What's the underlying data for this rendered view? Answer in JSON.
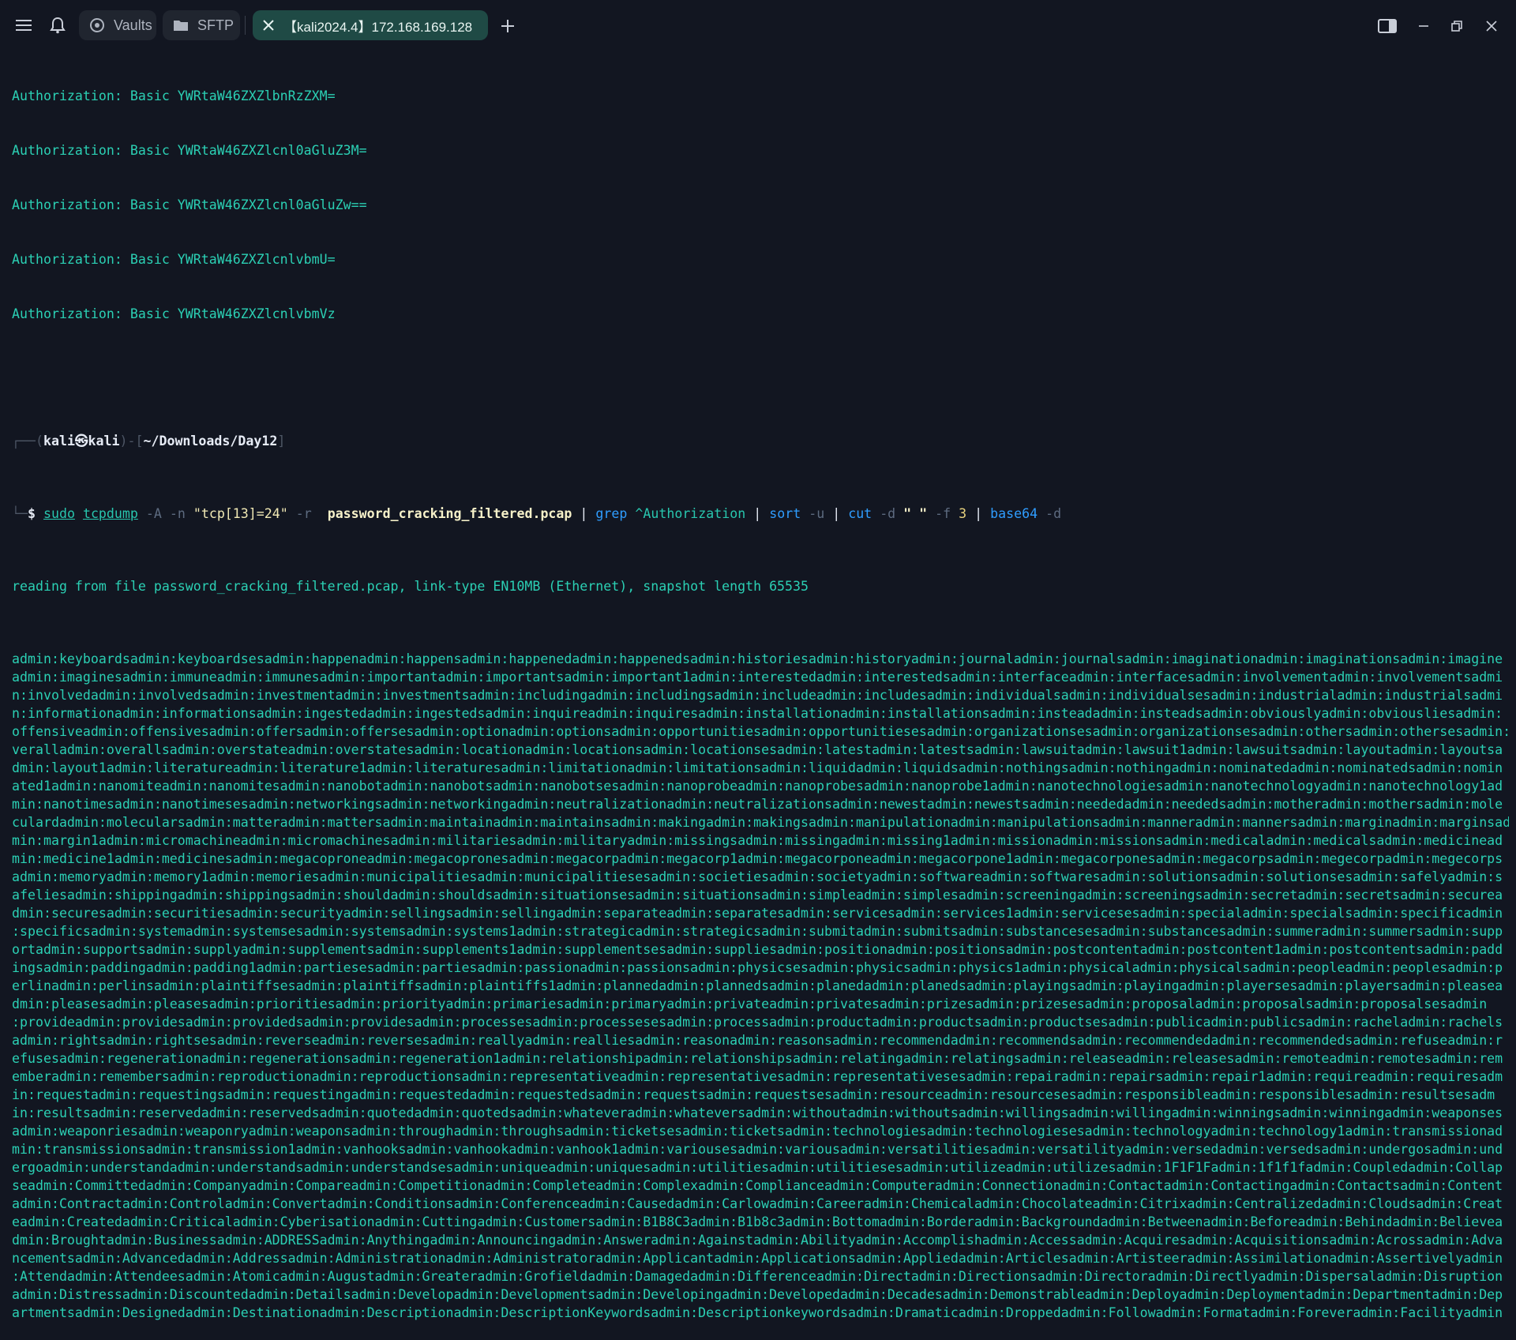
{
  "topbar": {
    "menu_icon": "hamburger-menu-icon",
    "bell_icon": "bell-icon",
    "vaults_label": "Vaults",
    "sftp_label": "SFTP",
    "active_tab_label": "【kali2024.4】172.168.169.128",
    "new_tab_icon": "plus-icon",
    "sidebar_toggle_icon": "sidebar-toggle-icon",
    "minimize_icon": "minimize-icon",
    "restore_icon": "restore-icon",
    "close_icon": "close-icon"
  },
  "colors": {
    "background": "#121621",
    "terminal_text": "#2bd0b4",
    "active_tab_bg": "#1f4a45"
  },
  "terminal": {
    "auth_lines": [
      "Authorization: Basic YWRtaW46ZXZlbnRzZXM=",
      "Authorization: Basic YWRtaW46ZXZlcnl0aGluZ3M=",
      "Authorization: Basic YWRtaW46ZXZlcnl0aGluZw==",
      "Authorization: Basic YWRtaW46ZXZlcnlvbmU=",
      "Authorization: Basic YWRtaW46ZXZlcnlvbmVz"
    ],
    "prompt": {
      "open": "┌──(",
      "user": "kali㉿kali",
      "mid": ")-[",
      "path": "~/Downloads/Day12",
      "close": "]",
      "second_prefix": "└─",
      "dollar": "$"
    },
    "command": {
      "sudo": "sudo",
      "tcpdump": "tcpdump",
      "flags1": "-A -n",
      "filter": "\"tcp[13]=24\"",
      "flag_r": "-r",
      "file": "password_cracking_filtered.pcap",
      "pipe1": "|",
      "grep": "grep",
      "grep_arg": "^Authorization",
      "pipe2": "|",
      "sort": "sort",
      "sort_flag": "-u",
      "pipe3": "|",
      "cut": "cut",
      "cut_d": "-d",
      "cut_delim": "\" \"",
      "cut_f": "-f",
      "cut_num": "3",
      "pipe4": "|",
      "base64": "base64",
      "base64_flag": "-d"
    },
    "reading_line": "reading from file password_cracking_filtered.pcap, link-type EN10MB (Ethernet), snapshot length 65535",
    "output_lines": [
      "admin:keyboardsadmin:keyboardsesadmin:happenadmin:happensadmin:happenedadmin:happenedsadmin:historiesadmin:historyadmin:journaladmin:journalsadmin:imaginationadmin:imaginationsadmin:imagine",
      "admin:imaginesadmin:immuneadmin:immunesadmin:importantadmin:importantsadmin:important1admin:interestedadmin:interestedsadmin:interfaceadmin:interfacesadmin:involvementadmin:involvementsadmi",
      "n:involvedadmin:involvedsadmin:investmentadmin:investmentsadmin:includingadmin:includingsadmin:includeadmin:includesadmin:individualsadmin:individualsesadmin:industrialadmin:industrialsadmi",
      "n:informationadmin:informationsadmin:ingestedadmin:ingestedsadmin:inquireadmin:inquiresadmin:installationadmin:installationsadmin:insteadadmin:insteadsadmin:obviouslyadmin:obviousliesadmin:",
      "offensiveadmin:offensivesadmin:offersadmin:offersesadmin:optionadmin:optionsadmin:opportunitiesadmin:opportunitiesesadmin:organizationsesadmin:organizationsesadmin:othersadmin:othersesadmin:o",
      "veralladmin:overallsadmin:overstateadmin:overstatesadmin:locationadmin:locationsadmin:locationsesadmin:latestadmin:latestsadmin:lawsuitadmin:lawsuit1admin:lawsuitsadmin:layoutadmin:layoutsa",
      "dmin:layout1admin:literatureadmin:literature1admin:literaturesadmin:limitationadmin:limitationsadmin:liquidadmin:liquidsadmin:nothingsadmin:nothingadmin:nominatedadmin:nominatedsadmin:nomin",
      "ated1admin:nanomiteadmin:nanomitesadmin:nanobotadmin:nanobotsadmin:nanobotsesadmin:nanoprobeadmin:nanoprobesadmin:nanoprobe1admin:nanotechnologiesadmin:nanotechnologyadmin:nanotechnology1ad",
      "min:nanotimesadmin:nanotimesesadmin:networkingsadmin:networkingadmin:neutralizationadmin:neutralizationsadmin:newestadmin:newestsadmin:neededadmin:neededsadmin:motheradmin:mothersadmin:mole",
      "culardadmin:molecularsadmin:matteradmin:mattersadmin:maintainadmin:maintainsadmin:makingadmin:makingsadmin:manipulationadmin:manipulationsadmin:manneradmin:mannersadmin:marginadmin:marginsad",
      "min:margin1admin:micromachineadmin:micromachinesadmin:militariesadmin:militaryadmin:missingsadmin:missingadmin:missing1admin:missionadmin:missionsadmin:medicaladmin:medicalsadmin:medicinead",
      "min:medicine1admin:medicinesadmin:megacoproneadmin:megacopronesadmin:megacorpadmin:megacorp1admin:megacorponeadmin:megacorpone1admin:megacorponesadmin:megacorpsadmin:megecorpadmin:megecorps",
      "admin:memoryadmin:memory1admin:memoriesadmin:municipalitiesadmin:municipalitiesesadmin:societiesadmin:societyadmin:softwareadmin:softwaresadmin:solutionsadmin:solutionsesadmin:safelyadmin:s",
      "afeliesadmin:shippingadmin:shippingsadmin:shouldadmin:shouldsadmin:situationsesadmin:situationsadmin:simpleadmin:simplesadmin:screeningadmin:screeningsadmin:secretadmin:secretsadmin:securea",
      "dmin:securesadmin:securitiesadmin:securityadmin:sellingsadmin:sellingadmin:separateadmin:separatesadmin:servicesadmin:services1admin:servicesesadmin:specialadmin:specialsadmin:specificadmin",
      ":specificsadmin:systemadmin:systemsesadmin:systemsadmin:systems1admin:strategicadmin:strategicsadmin:submitadmin:submitsadmin:substancesesadmin:substancesadmin:summeradmin:summersadmin:supp",
      "ortadmin:supportsadmin:supplyadmin:supplementsadmin:supplements1admin:supplementsesadmin:suppliesadmin:positionadmin:positionsadmin:postcontentadmin:postcontent1admin:postcontentsadmin:padd",
      "ingsadmin:paddingadmin:padding1admin:partiesesadmin:partiesadmin:passionadmin:passionsadmin:physicsesadmin:physicsadmin:physics1admin:physicaladmin:physicalsadmin:peopleadmin:peoplesadmin:p",
      "erlinadmin:perlinsadmin:plaintiffsesadmin:plaintiffsadmin:plaintiffs1admin:plannedadmin:plannedsadmin:planedadmin:planedsadmin:playingsadmin:playingadmin:playersesadmin:playersadmin:pleasea",
      "dmin:pleasesadmin:pleasesadmin:prioritiesadmin:priorityadmin:primariesadmin:primaryadmin:privateadmin:privatesadmin:prizesadmin:prizesesadmin:proposaladmin:proposalsadmin:proposalsesadmin",
      ":provideadmin:providesadmin:providedsadmin:providesadmin:processesadmin:processesesadmin:processadmin:productadmin:productsadmin:productsesadmin:publicadmin:publicsadmin:racheladmin:rachels",
      "admin:rightsadmin:rightsesadmin:reverseadmin:reversesadmin:reallyadmin:realliesadmin:reasonadmin:reasonsadmin:recommendadmin:recommendsadmin:recommendedadmin:recommendedsadmin:refuseadmin:r",
      "efusesadmin:regenerationadmin:regenerationsadmin:regeneration1admin:relationshipadmin:relationshipsadmin:relatingadmin:relatingsadmin:releaseadmin:releasesadmin:remoteadmin:remotesadmin:rem",
      "emberadmin:remembersadmin:reproductionadmin:reproductionsadmin:representativeadmin:representativesadmin:representativesesadmin:repairadmin:repairsadmin:repair1admin:requireadmin:requiresadm",
      "in:requestadmin:requestingsadmin:requestingadmin:requestedadmin:requestedsadmin:requestsadmin:requestsesadmin:resourceadmin:resourcesesadmin:responsibleadmin:responsiblesadmin:resultsesadm",
      "in:resultsadmin:reservedadmin:reservedsadmin:quotedadmin:quotedsadmin:whateveradmin:whateversadmin:withoutadmin:withoutsadmin:willingsadmin:willingadmin:winningsadmin:winningadmin:weaponses",
      "admin:weaponriesadmin:weaponryadmin:weaponsadmin:throughadmin:throughsadmin:ticketsesadmin:ticketsadmin:technologiesadmin:technologiesesadmin:technologyadmin:technology1admin:transmissionad",
      "min:transmissionsadmin:transmission1admin:vanhooksadmin:vanhookadmin:vanhook1admin:variousesadmin:variousadmin:versatilitiesadmin:versatilityadmin:versedadmin:versedsadmin:undergosadmin:und",
      "ergoadmin:understandadmin:understandsadmin:understandsesadmin:uniqueadmin:uniquesadmin:utilitiesadmin:utilitiesesadmin:utilizeadmin:utilizesadmin:1F1F1Fadmin:1f1f1fadmin:Coupledadmin:Collap",
      "seadmin:Committedadmin:Companyadmin:Compareadmin:Competitionadmin:Completeadmin:Complexadmin:Complianceadmin:Computeradmin:Connectionadmin:Contactadmin:Contactingadmin:Contactsadmin:Content",
      "admin:Contractadmin:Controladmin:Convertadmin:Conditionsadmin:Conferenceadmin:Causedadmin:Carlowadmin:Careeradmin:Chemicaladmin:Chocolateadmin:Citrixadmin:Centralizedadmin:Cloudsadmin:Creat",
      "eadmin:Createdadmin:Criticaladmin:Cyberisationadmin:Cuttingadmin:Customersadmin:B1B8C3admin:B1b8c3admin:Bottomadmin:Borderadmin:Backgroundadmin:Betweenadmin:Beforeadmin:Behindadmin:Believea",
      "dmin:Broughtadmin:Businessadmin:ADDRESSadmin:Anythingadmin:Announcingadmin:Answeradmin:Againstadmin:Abilityadmin:Accomplishadmin:Accessadmin:Acquiresadmin:Acquisitionsadmin:Acrossadmin:Adva",
      "ncementsadmin:Advancedadmin:Addressadmin:Administrationadmin:Administratoradmin:Applicantadmin:Applicationsadmin:Appliedadmin:Articlesadmin:Artisteeradmin:Assimilationadmin:Assertivelyadmin",
      ":Attendadmin:Attendeesadmin:Atomicadmin:Augustadmin:Greateradmin:Grofieldadmin:Damagedadmin:Differenceadmin:Directadmin:Directionsadmin:Directoradmin:Directlyadmin:Dispersaladmin:Disruption",
      "admin:Distressadmin:Discountedadmin:Detailsadmin:Developadmin:Developmentsadmin:Developingadmin:Developedadmin:Decadesadmin:Demonstrableadmin:Deployadmin:Deploymentadmin:Departmentadmin:Dep",
      "artmentsadmin:Designedadmin:Destinationadmin:Descriptionadmin:DescriptionKeywordsadmin:Descriptionkeywordsadmin:Dramaticadmin:Droppedadmin:Followadmin:Formatadmin:Foreveradmin:Facilityadmin"
    ]
  }
}
